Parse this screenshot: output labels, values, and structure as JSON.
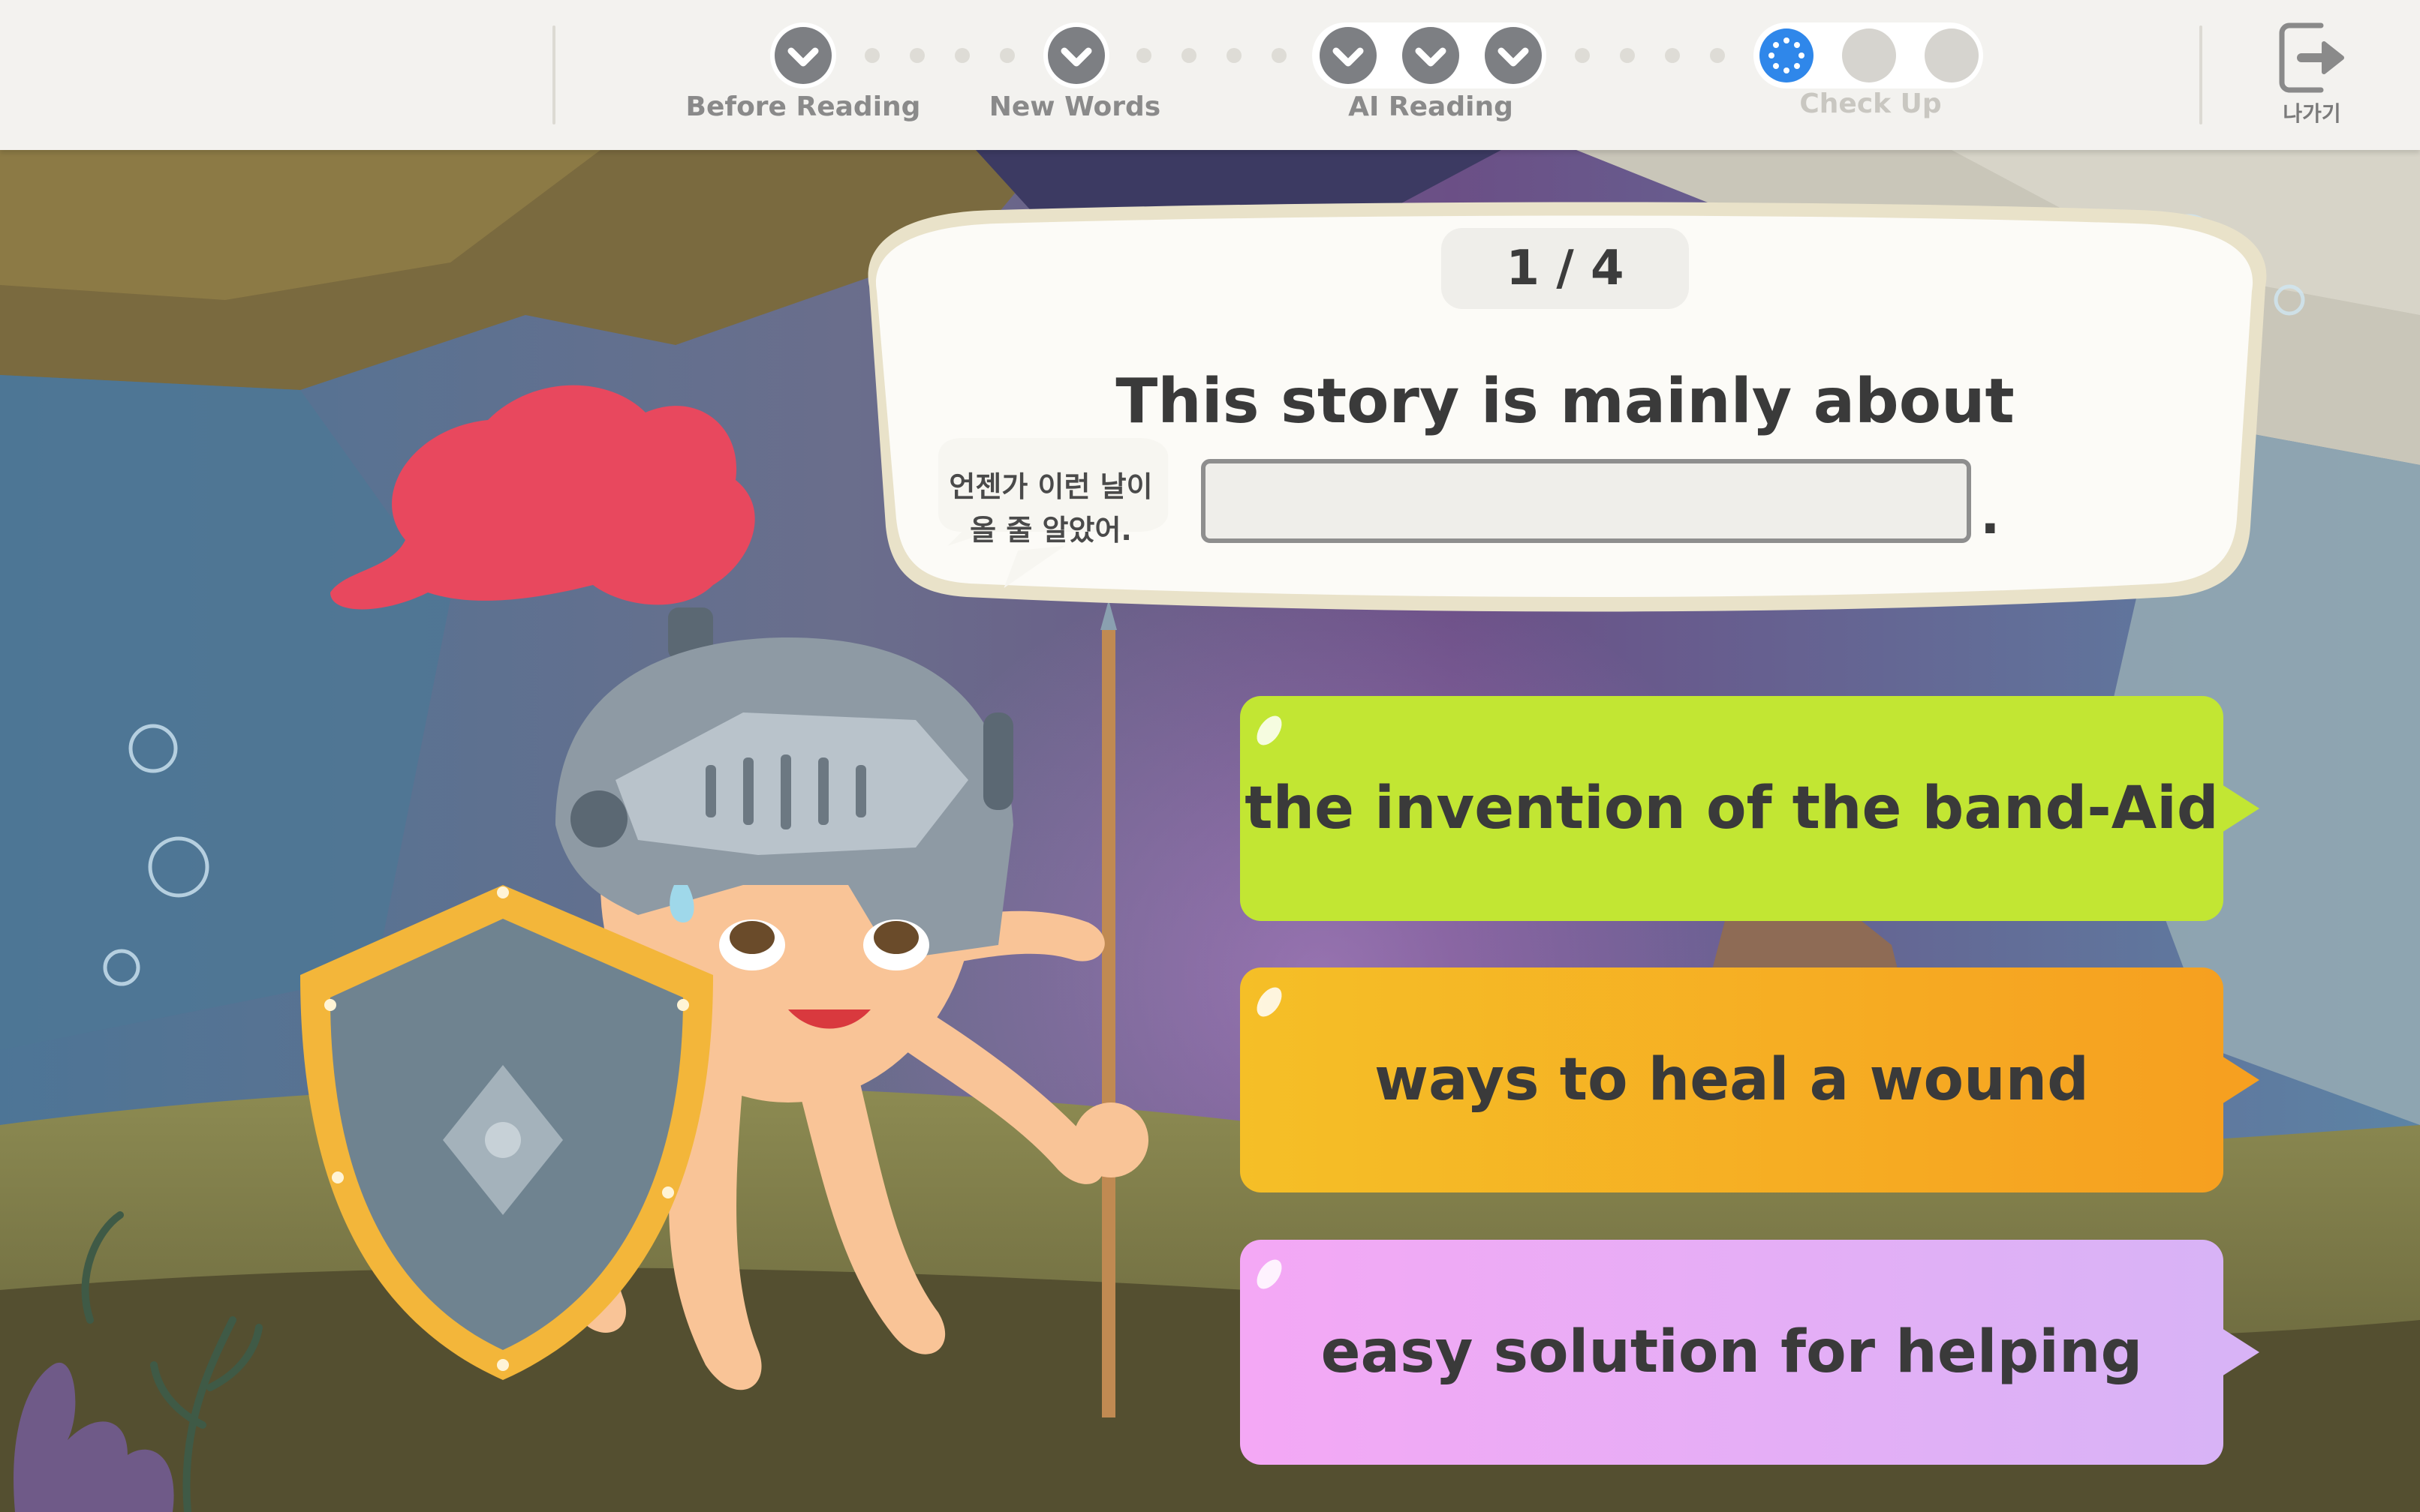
{
  "progress": {
    "steps": [
      {
        "label": "Before Reading"
      },
      {
        "label": "New Words"
      },
      {
        "label": "AI Reading"
      },
      {
        "label": "Check Up"
      }
    ],
    "exit_label": "나가기",
    "colors": {
      "completed": "#7d7f83",
      "active": "#2f87ea",
      "pending": "#d6d4cf"
    }
  },
  "quiz": {
    "counter": "1 / 4",
    "question": "This story is mainly about",
    "answer_value": "",
    "period": ".",
    "options": [
      {
        "label": "the invention of the band-Aid",
        "color": "#c2e633"
      },
      {
        "label": "ways to heal a wound",
        "color": "#f6a020"
      },
      {
        "label": "easy solution for helping",
        "color": "#e3aef6"
      }
    ]
  },
  "character": {
    "speech_line1": "언젠가 이런 날이",
    "speech_line2": "올 줄 알았어."
  }
}
